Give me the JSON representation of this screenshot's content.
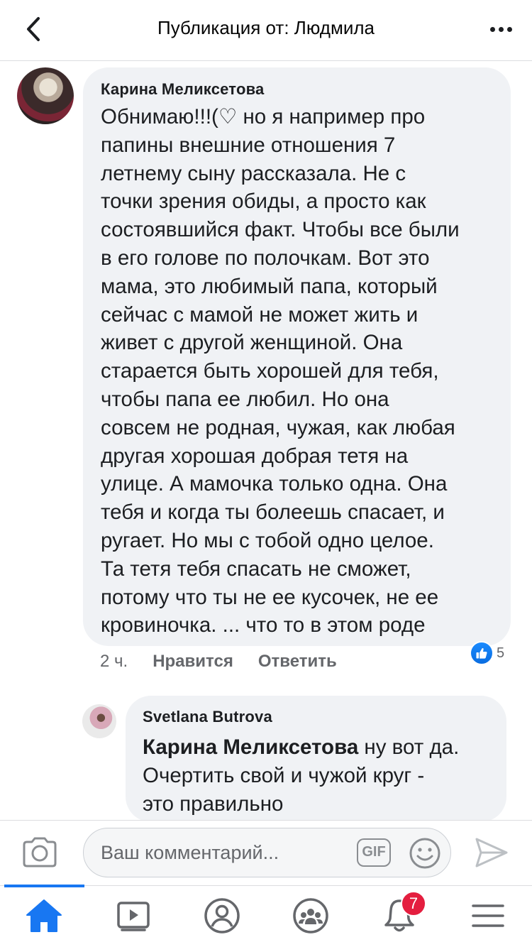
{
  "header": {
    "title": "Публикация от: Людмила"
  },
  "comments": [
    {
      "author": "Карина Меликсетова",
      "lines": [
        "Обнимаю!!!(♡ но я например про",
        "папины внешние отношения 7",
        "летнему сыну рассказала. Не с",
        "точки зрения обиды, а просто как",
        "состоявшийся факт. Чтобы все были",
        "в его голове по полочкам. Вот это",
        "мама, это любимый папа, который",
        "сейчас с мамой не может жить и",
        "живет с другой женщиной. Она",
        "старается быть хорошей для тебя,",
        "чтобы папа ее любил. Но она",
        "совсем не родная, чужая, как любая",
        "другая хорошая добрая тетя на",
        "улице. А мамочка только одна. Она",
        "тебя и когда ты болеешь спасает, и",
        "ругает. Но мы с тобой одно целое.",
        "Та тетя тебя спасать не сможет,",
        "потому что ты не ее кусочек, не ее",
        "кровиночка. ... что то  в этом роде"
      ],
      "time": "2 ч.",
      "like_label": "Нравится",
      "reply_label": "Ответить",
      "reaction_count": "5"
    },
    {
      "author": "Svetlana Butrova",
      "mention": "Карина Меликсетова",
      "line1_rest": " ну вот да.",
      "line2": "Очертить свой и чужой круг -",
      "line3": "это правильно"
    }
  ],
  "composer": {
    "placeholder": "Ваш комментарий...",
    "gif_label": "GIF"
  },
  "tabbar": {
    "notifications_badge": "7"
  },
  "colors": {
    "accent": "#1877f2",
    "bubble": "#f0f2f5",
    "badge": "#e41e3f"
  }
}
